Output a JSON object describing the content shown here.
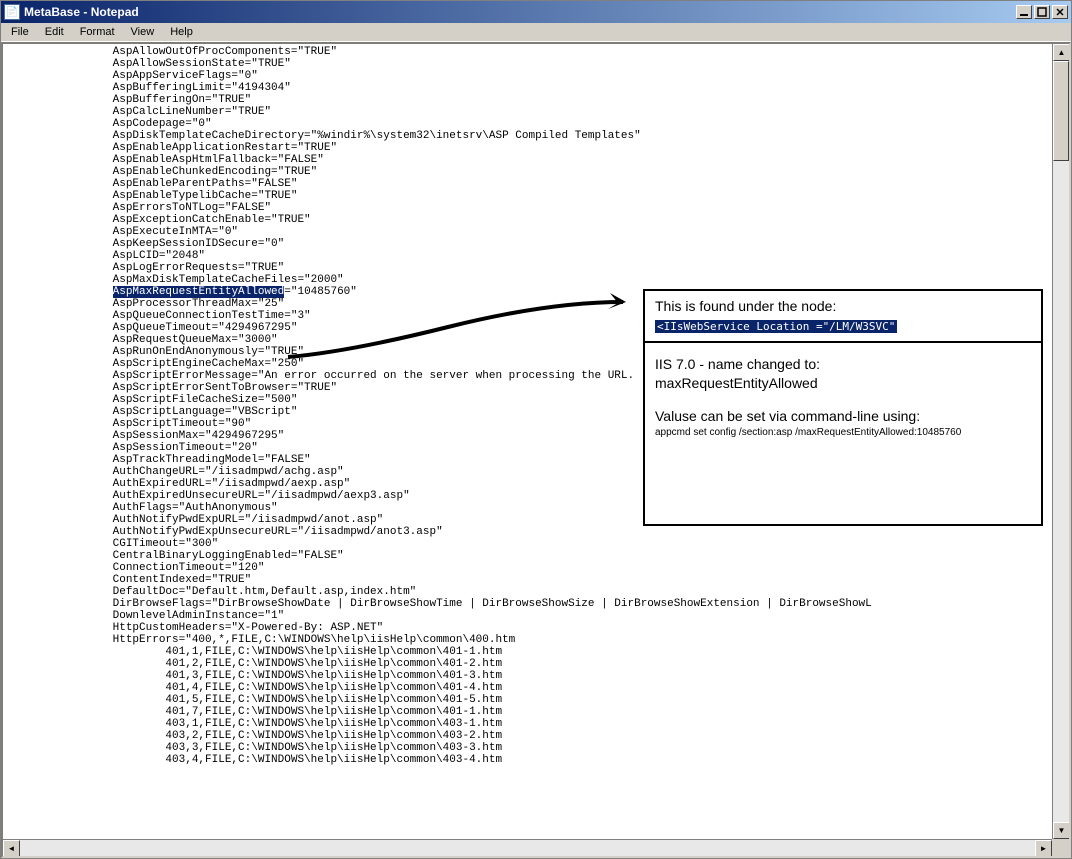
{
  "window": {
    "title": "MetaBase - Notepad"
  },
  "menu": {
    "file": "File",
    "edit": "Edit",
    "format": "Format",
    "view": "View",
    "help": "Help"
  },
  "highlighted_key": "AspMaxRequestEntityAllowed",
  "highlighted_rest": "=\"10485760\"",
  "lines_before": [
    "                AspAllowOutOfProcComponents=\"TRUE\"",
    "                AspAllowSessionState=\"TRUE\"",
    "                AspAppServiceFlags=\"0\"",
    "                AspBufferingLimit=\"4194304\"",
    "                AspBufferingOn=\"TRUE\"",
    "                AspCalcLineNumber=\"TRUE\"",
    "                AspCodepage=\"0\"",
    "                AspDiskTemplateCacheDirectory=\"%windir%\\system32\\inetsrv\\ASP Compiled Templates\"",
    "                AspEnableApplicationRestart=\"TRUE\"",
    "                AspEnableAspHtmlFallback=\"FALSE\"",
    "                AspEnableChunkedEncoding=\"TRUE\"",
    "                AspEnableParentPaths=\"FALSE\"",
    "                AspEnableTypelibCache=\"TRUE\"",
    "                AspErrorsToNTLog=\"FALSE\"",
    "                AspExceptionCatchEnable=\"TRUE\"",
    "                AspExecuteInMTA=\"0\"",
    "                AspKeepSessionIDSecure=\"0\"",
    "                AspLCID=\"2048\"",
    "                AspLogErrorRequests=\"TRUE\"",
    "                AspMaxDiskTemplateCacheFiles=\"2000\""
  ],
  "highlighted_prefix": "                ",
  "lines_after": [
    "                AspProcessorThreadMax=\"25\"",
    "                AspQueueConnectionTestTime=\"3\"",
    "                AspQueueTimeout=\"4294967295\"",
    "                AspRequestQueueMax=\"3000\"",
    "                AspRunOnEndAnonymously=\"TRUE\"",
    "                AspScriptEngineCacheMax=\"250\"",
    "                AspScriptErrorMessage=\"An error occurred on the server when processing the URL.  Please contact the system administ",
    "                AspScriptErrorSentToBrowser=\"TRUE\"",
    "                AspScriptFileCacheSize=\"500\"",
    "                AspScriptLanguage=\"VBScript\"",
    "                AspScriptTimeout=\"90\"",
    "                AspSessionMax=\"4294967295\"",
    "                AspSessionTimeout=\"20\"",
    "                AspTrackThreadingModel=\"FALSE\"",
    "                AuthChangeURL=\"/iisadmpwd/achg.asp\"",
    "                AuthExpiredURL=\"/iisadmpwd/aexp.asp\"",
    "                AuthExpiredUnsecureURL=\"/iisadmpwd/aexp3.asp\"",
    "                AuthFlags=\"AuthAnonymous\"",
    "                AuthNotifyPwdExpURL=\"/iisadmpwd/anot.asp\"",
    "                AuthNotifyPwdExpUnsecureURL=\"/iisadmpwd/anot3.asp\"",
    "                CGITimeout=\"300\"",
    "                CentralBinaryLoggingEnabled=\"FALSE\"",
    "                ConnectionTimeout=\"120\"",
    "                ContentIndexed=\"TRUE\"",
    "                DefaultDoc=\"Default.htm,Default.asp,index.htm\"",
    "                DirBrowseFlags=\"DirBrowseShowDate | DirBrowseShowTime | DirBrowseShowSize | DirBrowseShowExtension | DirBrowseShowL",
    "                DownlevelAdminInstance=\"1\"",
    "                HttpCustomHeaders=\"X-Powered-By: ASP.NET\"",
    "                HttpErrors=\"400,*,FILE,C:\\WINDOWS\\help\\iisHelp\\common\\400.htm",
    "                        401,1,FILE,C:\\WINDOWS\\help\\iisHelp\\common\\401-1.htm",
    "                        401,2,FILE,C:\\WINDOWS\\help\\iisHelp\\common\\401-2.htm",
    "                        401,3,FILE,C:\\WINDOWS\\help\\iisHelp\\common\\401-3.htm",
    "                        401,4,FILE,C:\\WINDOWS\\help\\iisHelp\\common\\401-4.htm",
    "                        401,5,FILE,C:\\WINDOWS\\help\\iisHelp\\common\\401-5.htm",
    "                        401,7,FILE,C:\\WINDOWS\\help\\iisHelp\\common\\401-1.htm",
    "                        403,1,FILE,C:\\WINDOWS\\help\\iisHelp\\common\\403-1.htm",
    "                        403,2,FILE,C:\\WINDOWS\\help\\iisHelp\\common\\403-2.htm",
    "                        403,3,FILE,C:\\WINDOWS\\help\\iisHelp\\common\\403-3.htm",
    "                        403,4,FILE,C:\\WINDOWS\\help\\iisHelp\\common\\403-4.htm"
  ],
  "callout1": {
    "line1": "This is found under the node:",
    "line2": "<IIsWebService   Location =\"/LM/W3SVC\""
  },
  "callout2": {
    "line1": "IIS 7.0 - name changed to:",
    "line2": "maxRequestEntityAllowed",
    "line3": "Valuse can be set via command-line using:",
    "line4": "appcmd set config /section:asp /maxRequestEntityAllowed:10485760"
  }
}
